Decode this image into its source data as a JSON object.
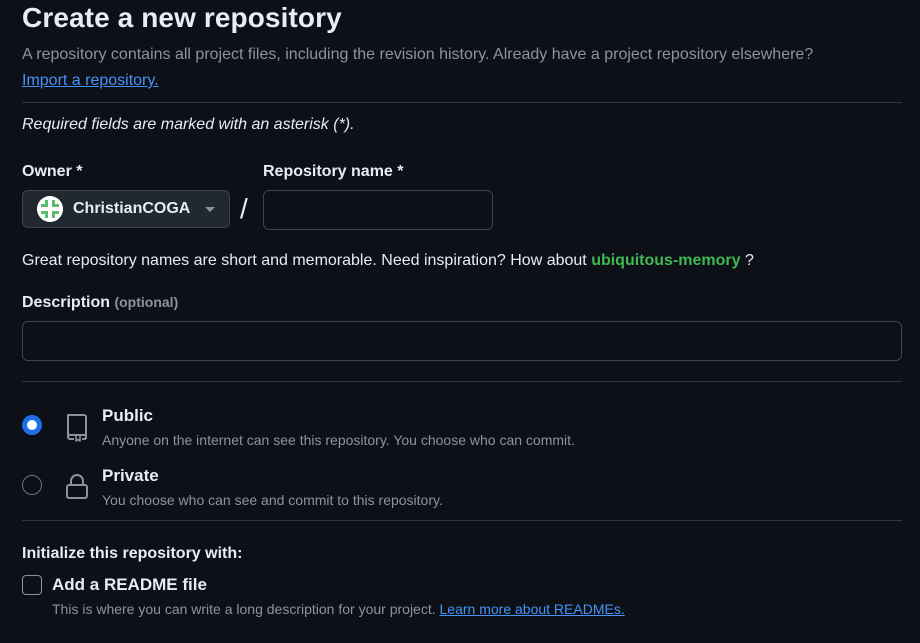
{
  "header": {
    "title": "Create a new repository",
    "intro_text": "A repository contains all project files, including the revision history. Already have a project repository elsewhere?",
    "import_link": "Import a repository."
  },
  "required_note": "Required fields are marked with an asterisk (*).",
  "owner": {
    "label": "Owner *",
    "selected": "ChristianCOGA",
    "avatar_color": "#5cbb6d"
  },
  "separator": "/",
  "repo_name": {
    "label": "Repository name *",
    "value": "",
    "placeholder": ""
  },
  "suggestion": {
    "prefix": "Great repository names are short and memorable. Need inspiration? How about",
    "name": "ubiquitous-memory",
    "suffix": "?"
  },
  "description": {
    "label": "Description",
    "optional": "(optional)",
    "value": ""
  },
  "visibility": {
    "options": [
      {
        "title": "Public",
        "desc": "Anyone on the internet can see this repository. You choose who can commit.",
        "icon": "repo-icon",
        "checked": true
      },
      {
        "title": "Private",
        "desc": "You choose who can see and commit to this repository.",
        "icon": "lock-icon",
        "checked": false
      }
    ]
  },
  "initialize": {
    "title": "Initialize this repository with:",
    "readme_label": "Add a README file",
    "readme_desc": "This is where you can write a long description for your project.",
    "readme_link": "Learn more about READMEs.",
    "readme_checked": false
  },
  "colors": {
    "background": "#0d1117",
    "accent_link": "#4493f8",
    "suggestion": "#3fb950",
    "radio_checked": "#1f6feb",
    "border": "#30363d"
  }
}
